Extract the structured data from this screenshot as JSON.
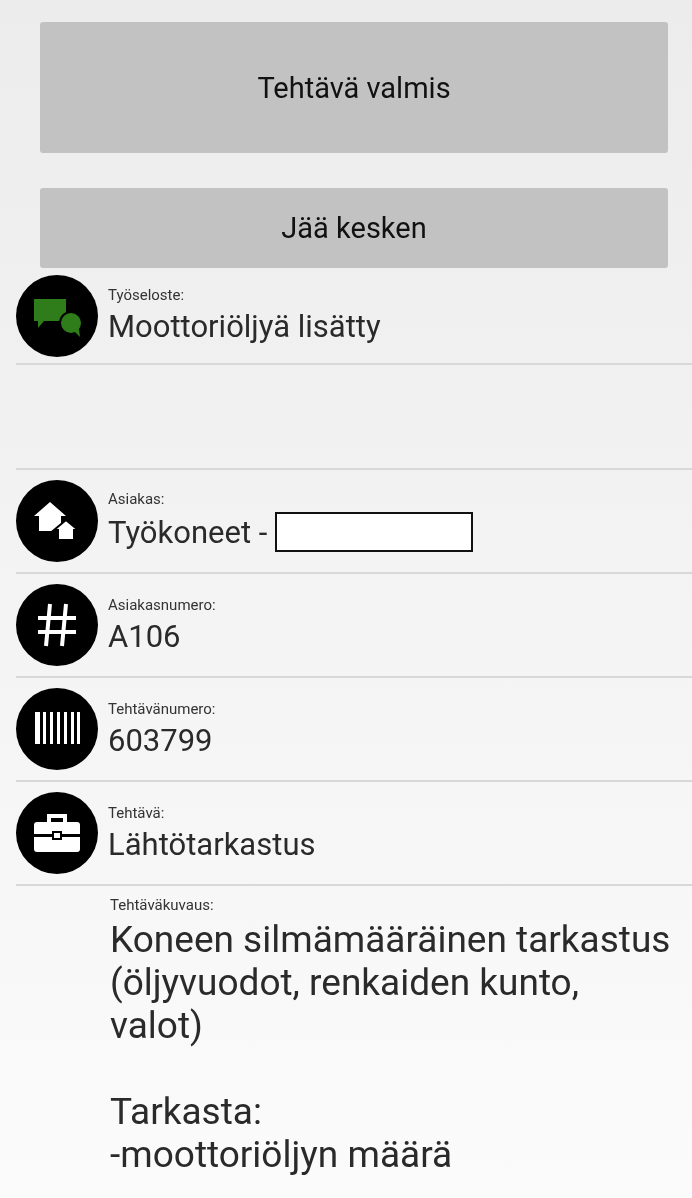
{
  "buttons": [
    {
      "label": "Tehtävä valmis",
      "kind": "tall"
    },
    {
      "label": "Jää kesken",
      "kind": "short"
    }
  ],
  "work_log": {
    "kind": "chat",
    "label": "Työseloste:",
    "value": "Moottoriöljyä lisätty"
  },
  "fields": [
    {
      "kind": "home",
      "label": "Asiakas:",
      "value": "Työkoneet -",
      "redacted": true
    },
    {
      "kind": "hash",
      "label": "Asiakasnumero:",
      "value": "A106",
      "redacted": false
    },
    {
      "kind": "barcode",
      "label": "Tehtävänumero:",
      "value": "603799",
      "redacted": false
    },
    {
      "kind": "briefcase",
      "label": "Tehtävä:",
      "value": "Lähtötarkastus",
      "redacted": false
    }
  ],
  "description": {
    "label": "Tehtäväkuvaus:",
    "value": "Koneen silmämääräinen tarkastus (öljyvuodot, renkaiden kunto, valot)\n\nTarkasta:\n-moottoriöljyn määrä"
  }
}
